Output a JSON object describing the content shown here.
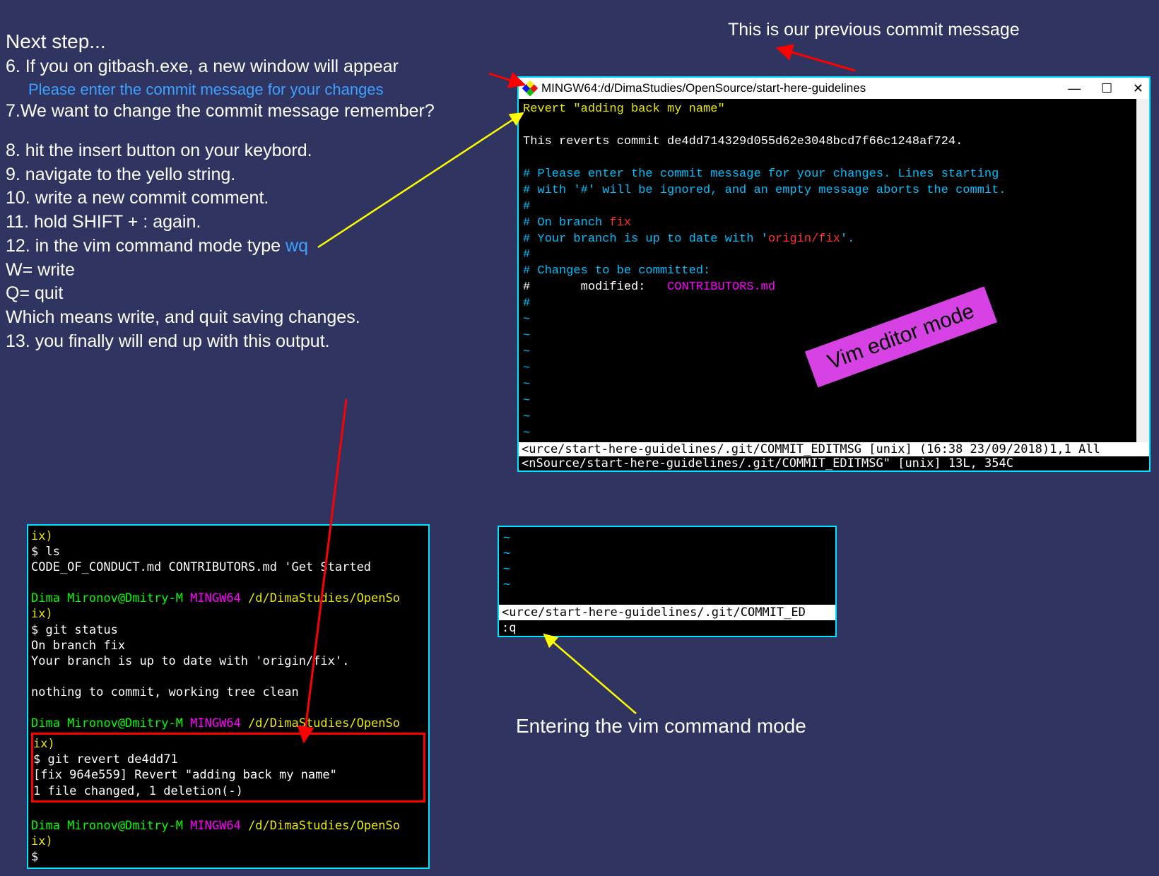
{
  "annotation_top": "This is our previous commit message",
  "annotation_bottom": "Entering the vim command mode",
  "vim_badge": "Vim editor mode",
  "instructions": {
    "title": "Next step...",
    "line6": "6. If you on gitbash.exe, a new window will appear",
    "line6_blue": "Please enter the commit message for your changes",
    "line7": "7.We want to change the commit message remember?",
    "line8": "8. hit the insert button on your keybord.",
    "line9": "9. navigate to the yello string.",
    "line10": "10. write a new commit comment.",
    "line11": "11. hold SHIFT + : again.",
    "line12a": "12. in the vim command mode type ",
    "line12b": "wq",
    "line_w": "W= write",
    "line_q": "Q= quit",
    "line_explain": "Which means write, and quit saving changes.",
    "line13": "13. you finally will end up with this output."
  },
  "vim": {
    "title": "MINGW64:/d/DimaStudies/OpenSource/start-here-guidelines",
    "btn_min": "—",
    "btn_max": "☐",
    "btn_close": "✕",
    "revert_line": "Revert \"adding back my name\"",
    "reverts_commit": "This reverts commit de4dd714329d055d62e3048bcd7f66c1248af724.",
    "c1": "# Please enter the commit message for your changes. Lines starting",
    "c2": "# with '#' will be ignored, and an empty message aborts the commit.",
    "hash": "#",
    "on_branch_prefix": "# On branch ",
    "on_branch_name": "fix",
    "up_to_date_pre": "# Your branch is up to date with '",
    "up_to_date_branch": "origin/fix",
    "up_to_date_post": "'.",
    "changes": "# Changes to be committed:",
    "modified_prefix": "#       modified:   ",
    "modified_file": "CONTRIBUTORS.md",
    "tilde": "~",
    "statusbar": "<urce/start-here-guidelines/.git/COMMIT_EDITMSG [unix] (16:38 23/09/2018)1,1 All",
    "cmdline": "<nSource/start-here-guidelines/.git/COMMIT_EDITMSG\" [unix] 13L, 354C"
  },
  "term_left": {
    "ix": "ix)",
    "ls": "$ ls",
    "ls_output": " CODE_OF_CONDUCT.md   CONTRIBUTORS.md  'Get Started",
    "prompt_user": "Dima Mironov@Dmitry-M ",
    "prompt_host": "MINGW64 ",
    "prompt_path": "/d/DimaStudies/OpenSo",
    "git_status": "$ git status",
    "on_branch": "On branch fix",
    "up_to_date": "Your branch is up to date with 'origin/fix'.",
    "nothing": "nothing to commit, working tree clean",
    "revert_cmd": "$ git revert de4dd71",
    "revert_out1": "[fix 964e559] Revert \"adding back my name\"",
    "revert_out2": " 1 file changed, 1 deletion(-)",
    "dollar": "$ "
  },
  "term_mid": {
    "tilde": "~",
    "statusbar": "<urce/start-here-guidelines/.git/COMMIT_ED",
    "cmdline": ":q"
  }
}
